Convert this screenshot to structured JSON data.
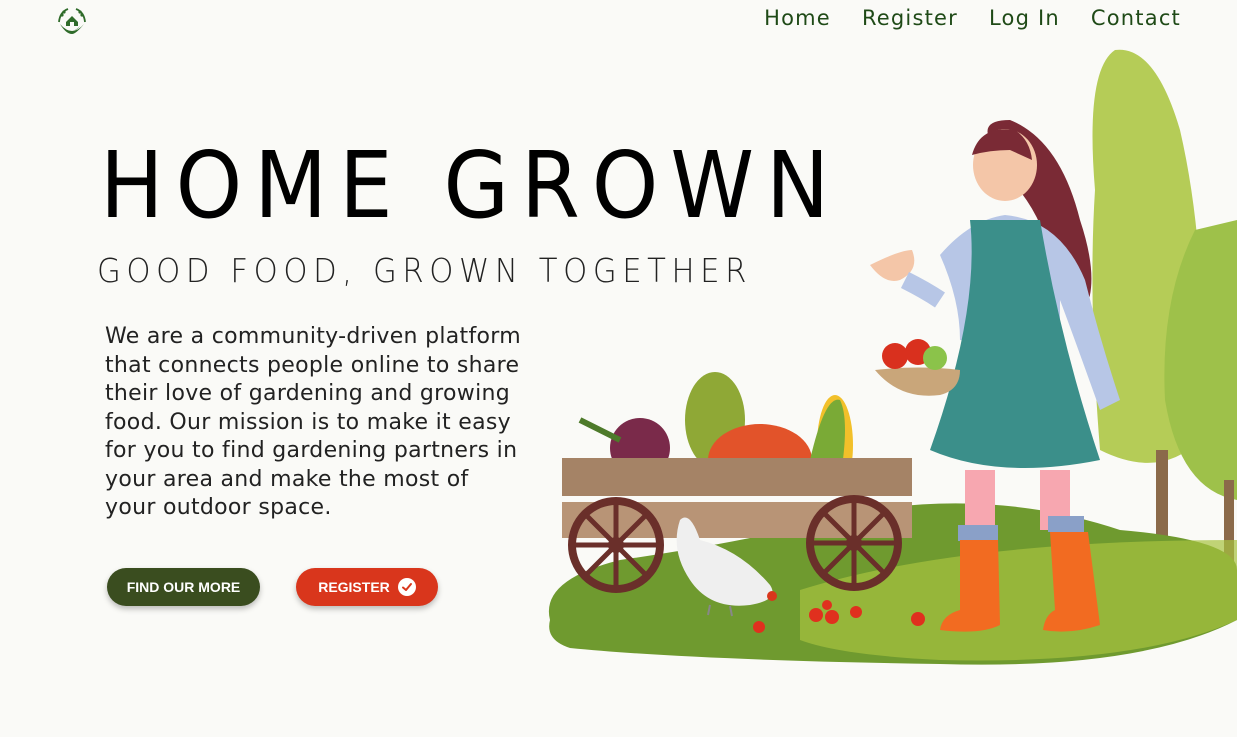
{
  "nav": {
    "items": [
      {
        "label": "Home"
      },
      {
        "label": "Register"
      },
      {
        "label": "Log In"
      },
      {
        "label": "Contact"
      }
    ]
  },
  "hero": {
    "title": "HOME GROWN",
    "subtitle": "GOOD FOOD, GROWN TOGETHER",
    "description": "We are a community-driven platform that connects people online to share their love of gardening and growing food. Our mission is to make it easy for you to find gardening partners in your area and make the most of your outdoor space."
  },
  "buttons": {
    "find_label": "FIND OUR MORE",
    "register_label": "REGISTER"
  },
  "colors": {
    "background": "#fafaf7",
    "nav_text": "#1f4a17",
    "primary_button": "#3a4d1f",
    "accent_button": "#d9361c"
  },
  "icons": {
    "logo": "leaf-house-logo",
    "register_check": "check-circle-icon"
  }
}
